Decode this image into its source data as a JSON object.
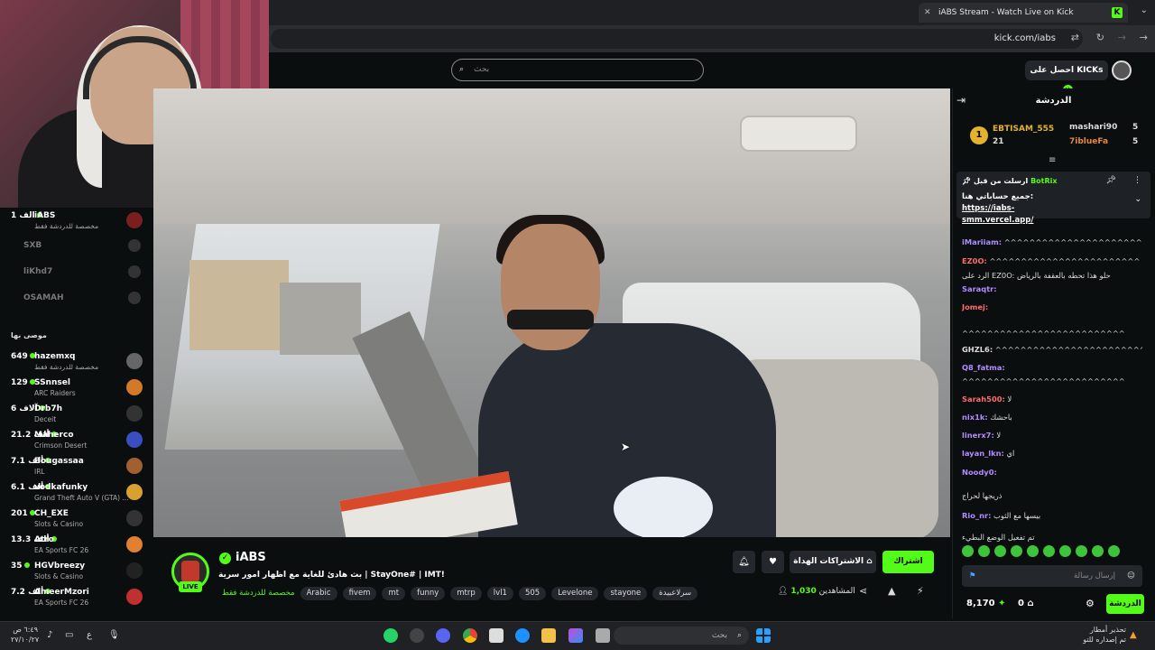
{
  "browser": {
    "tab_title": "iABS Stream - Watch Live on Kick",
    "url": "kick.com/iabs"
  },
  "header": {
    "search_placeholder": "بحث",
    "get_kicks": "احصل على KICKs"
  },
  "sidebar": {
    "live_top": {
      "name": "iABS",
      "count": "1 الف",
      "sub": "مخصصة للدردشة فقط"
    },
    "offline": [
      "SXB",
      "liKhd7",
      "OSAMAH"
    ],
    "recommended_label": "موصى بها",
    "recommended": [
      {
        "count": "649",
        "name": "hazemxq",
        "sub": "مخصصة للدردشة فقط",
        "color": "#666"
      },
      {
        "count": "129",
        "name": "SSnnsel",
        "sub": "ARC Raiders",
        "color": "#d27a2a"
      },
      {
        "count": "6 آلاف",
        "name": "Drb7h",
        "sub": "Deceit",
        "color": "#333"
      },
      {
        "count": "21.2 ألف",
        "name": "Maherco",
        "sub": "Crimson Desert",
        "color": "#3a4fbf"
      },
      {
        "count": "7.1 ألف",
        "name": "Bougassaa",
        "sub": "IRL",
        "color": "#a06030"
      },
      {
        "count": "6.1 ألف",
        "name": "vodkafunky",
        "sub": "Grand Theft Auto V (GTA) ...",
        "color": "#d8a030"
      },
      {
        "count": "201",
        "name": "CH_EXE",
        "sub": "Slots & Casino",
        "color": "#333"
      },
      {
        "count": "13.3 ألف",
        "name": "Atro",
        "sub": "EA Sports FC 26",
        "color": "#e08030"
      },
      {
        "count": "35",
        "name": "HGVbreezy",
        "sub": "Slots & Casino",
        "color": "#222"
      },
      {
        "count": "7.2 ألف",
        "name": "AmeerMzori",
        "sub": "EA Sports FC 26",
        "color": "#c03030"
      }
    ]
  },
  "stream": {
    "channel": "iABS",
    "live_badge": "LIVE",
    "title": "بث هادئ للغاية مع اظهار امور سرية | StayOne# | IMT!",
    "category": "مخصصة للدردشة فقط",
    "tags": [
      "Arabic",
      "fivem",
      "mt",
      "funny",
      "mtrp",
      "lvl1",
      "505",
      "Levelone",
      "stayone",
      "سرلاعبيدة"
    ],
    "follow": "اشتراك",
    "gift_subs": "الاشتراكات الهداة",
    "viewers_label": "المشاهدين",
    "viewers": "1,030"
  },
  "chat": {
    "title": "الدردشة",
    "gifters": [
      {
        "name": "EBTISAM_555",
        "amount": "21"
      },
      {
        "name": "mashari90",
        "amount": "5"
      },
      {
        "name": "7ibluеFa",
        "amount": "5"
      }
    ],
    "gifter_rank": "1",
    "pinned": {
      "header": "ارسلت من قبل",
      "user": "BotRix",
      "text": "جميع حساباتي هنا:",
      "link": "https://iabs-smm.vercel.app/"
    },
    "messages": [
      {
        "user": "iMariiam:",
        "text": "^^^^^^^^^^^^^^^^^^^^^^^^",
        "color": "#b18cff"
      },
      {
        "user": "EZ0O:",
        "text": "^^^^^^^^^^^^^^^^^^^^^^^^",
        "color": "#ff6b6b"
      },
      {
        "user": "",
        "text": "الرد على EZ0O: حلو هذا تحطه بالعقفة بالرياض",
        "color": "#888"
      },
      {
        "user": "Saraqtr:",
        "text": "",
        "color": "#b18cff"
      },
      {
        "user": "Jomej:",
        "text": "",
        "color": "#ff6b6b"
      },
      {
        "user": "",
        "text": "^^^^^^^^^^^^^^^^^^^^^^^^^^",
        "color": "#ddd"
      },
      {
        "user": "GHZL6:",
        "text": "^^^^^^^^^^^^^^^^^^^^^^^^",
        "color": "#ddd"
      },
      {
        "user": "Q8_fatma:",
        "text": "",
        "color": "#b18cff"
      },
      {
        "user": "",
        "text": "^^^^^^^^^^^^^^^^^^^^^^^^^^",
        "color": "#ddd"
      },
      {
        "user": "Sarah500:",
        "text": "لا",
        "color": "#ff6b6b"
      },
      {
        "user": "nix1k:",
        "text": "باحشك",
        "color": "#b18cff"
      },
      {
        "user": "linerx7:",
        "text": "لا",
        "color": "#b18cff"
      },
      {
        "user": "layan_lkn:",
        "text": "اي",
        "color": "#b18cff"
      },
      {
        "user": "Noody0:",
        "text": "",
        "color": "#b18cff"
      },
      {
        "user": "",
        "text": "ذريجها لحراج",
        "color": "#ddd"
      },
      {
        "user": "Rio_nr:",
        "text": "بيسها مع الثوب",
        "color": "#b18cff"
      },
      {
        "user": "",
        "text": "تم تفعيل الوضع البطيء",
        "color": "#888"
      }
    ],
    "input_placeholder": "إرسال رسالة",
    "chat_button": "الدردشة",
    "kicks_balance": "8,170",
    "zero": "0"
  },
  "taskbar": {
    "search": "بحث",
    "time": "٦:٤٩ ص",
    "date": "٢٧/١٠/٢٧",
    "weather_title": "تحذير أمطار",
    "weather_sub": "تم إصداره للتو"
  }
}
